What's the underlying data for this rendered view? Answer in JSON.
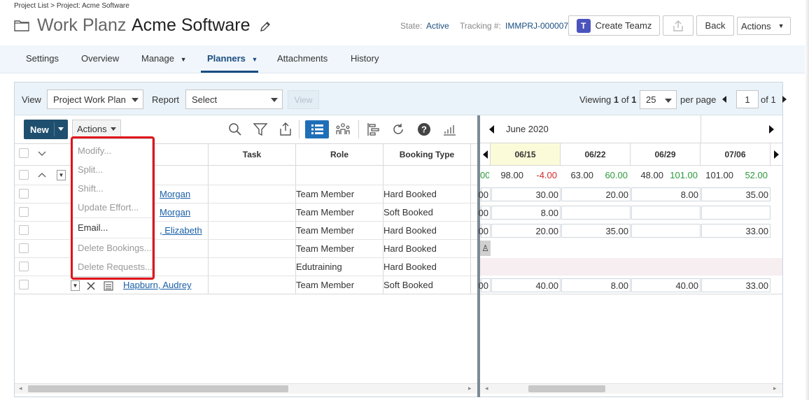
{
  "breadcrumb": "Project List > Project: Acme Software",
  "header": {
    "title_prefix": "Work Planz",
    "title_name": "Acme Software",
    "state_label": "State:",
    "state_value": "Active",
    "tracking_label": "Tracking #:",
    "tracking_value": "IMMPRJ-000007",
    "teams_button": "Create Teamz",
    "back_button": "Back",
    "actions_button": "Actions"
  },
  "tabs": [
    {
      "label": "Settings"
    },
    {
      "label": "Overview"
    },
    {
      "label": "Manage"
    },
    {
      "label": "Planners",
      "active": true
    },
    {
      "label": "Attachments"
    },
    {
      "label": "History"
    }
  ],
  "toolbar": {
    "view_label": "View",
    "view_value": "Project Work Plan",
    "report_label": "Report",
    "report_value": "Select",
    "view_button": "View",
    "viewing_prefix": "Viewing",
    "viewing_current": "1",
    "viewing_of": "of",
    "viewing_total": "1",
    "per_page_value": "25",
    "per_page_label": "per page",
    "page_input": "1",
    "page_of": "of 1"
  },
  "grid_toolbar": {
    "new_button": "New",
    "actions_button": "Actions"
  },
  "columns": {
    "task": "Task",
    "role": "Role",
    "booking_type": "Booking Type"
  },
  "rows": [
    {
      "name": "Morgan",
      "role": "Team Member",
      "booking": "Hard Booked"
    },
    {
      "name": "Morgan",
      "role": "Team Member",
      "booking": "Soft Booked"
    },
    {
      "name": ", Elizabeth",
      "role": "Team Member",
      "booking": "Hard Booked"
    },
    {
      "name": "",
      "role": "Team Member",
      "booking": "Hard Booked"
    },
    {
      "name": "",
      "role": "Edutraining",
      "booking": "Hard Booked"
    },
    {
      "name": "Hapburn, Audrey",
      "role": "Team Member",
      "booking": "Soft Booked"
    }
  ],
  "calendar": {
    "month": "June 2020",
    "weeks": [
      "06/15",
      "06/22",
      "06/29",
      "07/06"
    ],
    "summary": [
      {
        "a": "98.00",
        "b": "-4.00"
      },
      {
        "a": "63.00",
        "b": "60.00"
      },
      {
        "a": "48.00",
        "b": "101.00"
      },
      {
        "a": "101.00",
        "b": "52.00"
      }
    ],
    "summary_prefix": "00",
    "row_prefix": "00",
    "values": [
      [
        "30.00",
        "20.00",
        "8.00",
        "35.00"
      ],
      [
        "8.00",
        "",
        "",
        ""
      ],
      [
        "20.00",
        "35.00",
        "",
        "33.00"
      ],
      [
        "",
        "",
        "",
        ""
      ],
      [
        "",
        "",
        "",
        ""
      ],
      [
        "40.00",
        "8.00",
        "40.00",
        "33.00"
      ]
    ]
  },
  "actions_menu": [
    {
      "label": "Modify...",
      "enabled": false
    },
    {
      "label": "Split...",
      "enabled": false
    },
    {
      "label": "Shift...",
      "enabled": false
    },
    {
      "label": "Update Effort...",
      "enabled": false
    },
    {
      "label": "Email...",
      "enabled": true
    },
    {
      "label": "Delete Bookings...",
      "enabled": false
    },
    {
      "label": "Delete Requests...",
      "enabled": false
    }
  ],
  "colors": {
    "brand_dark": "#1f4f6e",
    "accent": "#1a4d80",
    "highlight_border": "#e0131b",
    "positive": "#2c9a3a",
    "negative": "#d12a2a",
    "teams": "#4b53bc"
  }
}
